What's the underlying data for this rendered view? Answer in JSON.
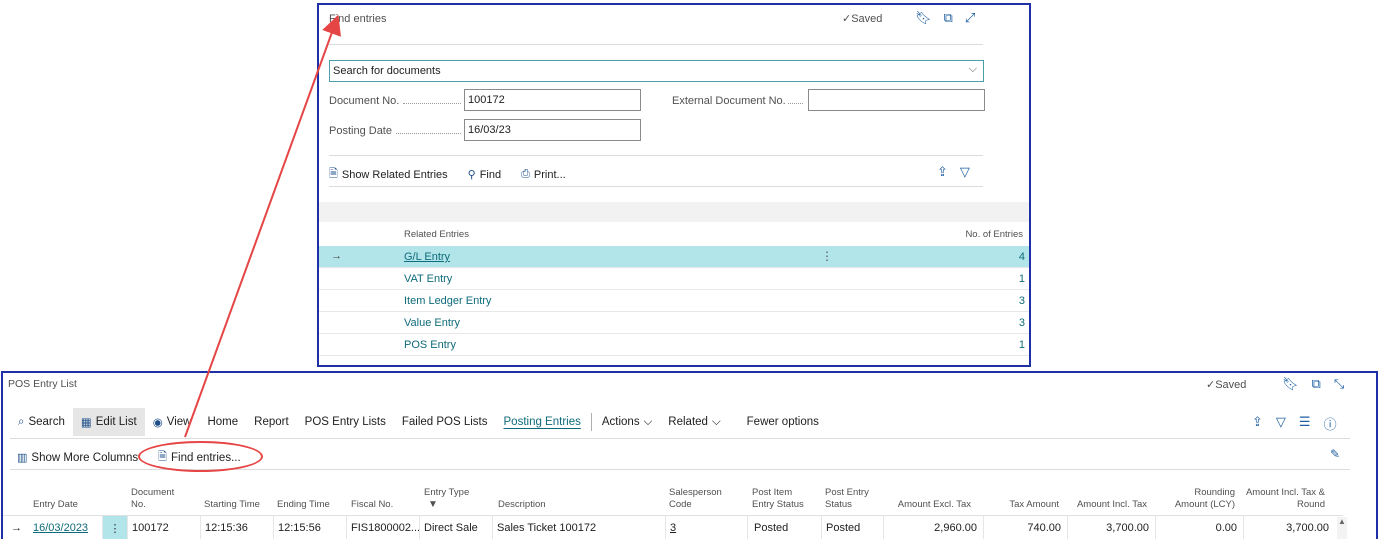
{
  "dialog": {
    "title": "Find entries",
    "saved": "Saved",
    "search_label": "Search for documents",
    "document_no_label": "Document No.",
    "document_no_value": "100172",
    "external_document_no_label": "External Document No.",
    "external_document_no_value": "",
    "posting_date_label": "Posting Date",
    "posting_date_value": "16/03/23",
    "actions": [
      "Show Related Entries",
      "Find",
      "Print..."
    ],
    "related_header": "Related Entries",
    "count_header": "No. of Entries",
    "rows": [
      {
        "name": "G/L Entry",
        "count": "4"
      },
      {
        "name": "VAT Entry",
        "count": "1"
      },
      {
        "name": "Item Ledger Entry",
        "count": "3"
      },
      {
        "name": "Value Entry",
        "count": "3"
      },
      {
        "name": "POS Entry",
        "count": "1"
      }
    ]
  },
  "pos": {
    "title": "POS Entry List",
    "saved": "Saved",
    "menu": {
      "search": "Search",
      "edit_list": "Edit List",
      "view": "View",
      "home": "Home",
      "report": "Report",
      "pos_entry_lists": "POS Entry Lists",
      "failed_pos_lists": "Failed POS Lists",
      "posting_entries": "Posting Entries",
      "actions": "Actions",
      "related": "Related",
      "fewer_options": "Fewer options"
    },
    "show_more_columns": "Show More Columns",
    "find_entries": "Find entries...",
    "columns": {
      "entry_date": "Entry Date",
      "document_no": "Document No.",
      "starting_time": "Starting Time",
      "ending_time": "Ending Time",
      "fiscal_no": "Fiscal No.",
      "entry_type": "Entry Type",
      "description": "Description",
      "salesperson_code": "Salesperson Code",
      "post_item_entry_status": "Post Item Entry Status",
      "post_entry_status": "Post Entry Status",
      "amount_excl_tax": "Amount Excl. Tax",
      "tax_amount": "Tax Amount",
      "amount_incl_tax": "Amount Incl. Tax",
      "rounding_amount": "Rounding Amount (LCY)",
      "amount_incl_tax_round": "Amount Incl. Tax & Round"
    },
    "row": {
      "entry_date": "16/03/2023",
      "document_no": "100172",
      "starting_time": "12:15:36",
      "ending_time": "12:15:56",
      "fiscal_no": "FIS1800002...",
      "entry_type": "Direct Sale",
      "description": "Sales Ticket 100172",
      "salesperson_code": "3",
      "post_item_entry_status": "Posted",
      "post_entry_status": "Posted",
      "amount_excl_tax": "2,960.00",
      "tax_amount": "740.00",
      "amount_incl_tax": "3,700.00",
      "rounding_amount": "0.00",
      "amount_incl_tax_round": "3,700.00"
    }
  },
  "colors": {
    "window_border": "#1f2fa8",
    "selected_row": "#b2e5e9",
    "link": "#0e6b7a",
    "annotation": "#e64545"
  }
}
